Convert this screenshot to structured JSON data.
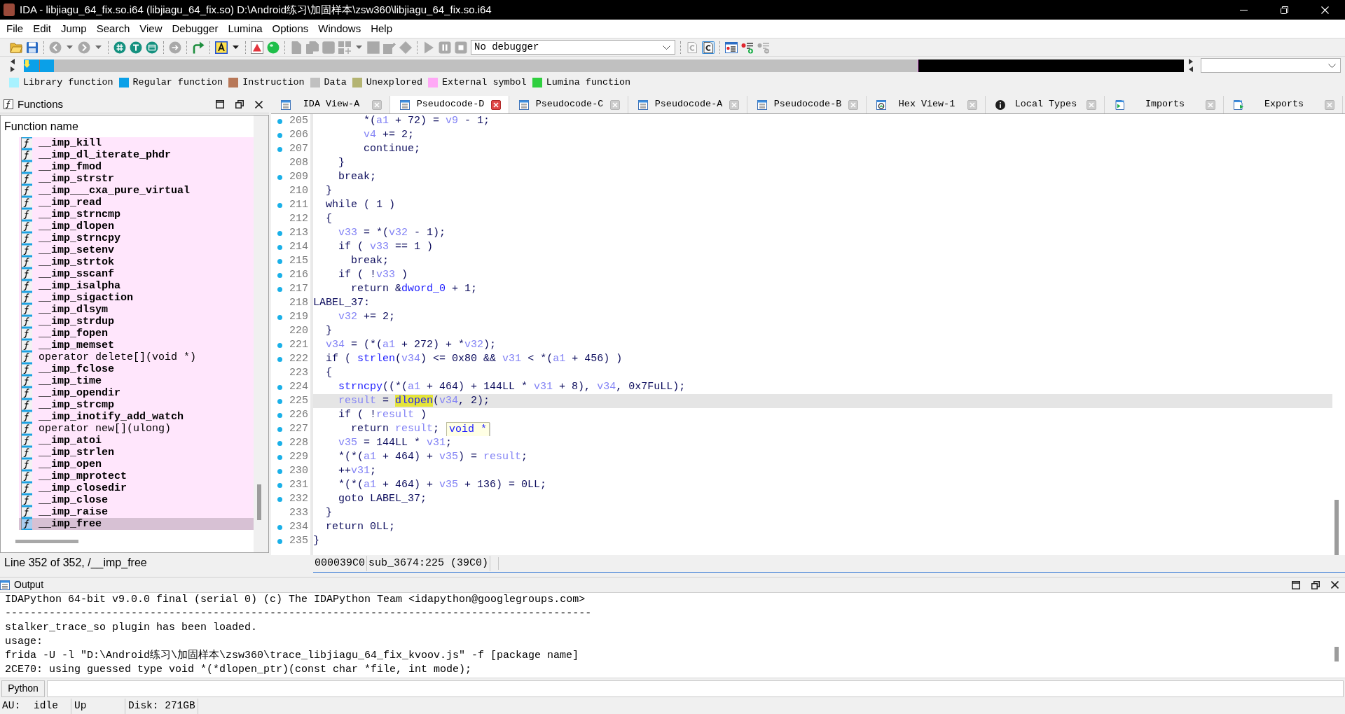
{
  "window": {
    "title": "IDA - libjiagu_64_fix.so.i64 (libjiagu_64_fix.so) D:\\Android练习\\加固样本\\zsw360\\libjiagu_64_fix.so.i64"
  },
  "menu": [
    "File",
    "Edit",
    "Jump",
    "Search",
    "View",
    "Debugger",
    "Lumina",
    "Options",
    "Windows",
    "Help"
  ],
  "toolbar": [
    [
      {
        "kind": "folder",
        "disabled": false,
        "pressed": false
      },
      {
        "kind": "save",
        "disabled": false,
        "pressed": false
      }
    ],
    [
      {
        "kind": "back",
        "disabled": true,
        "pressed": false
      },
      {
        "kind": "caret",
        "disabled": true,
        "pressed": false
      },
      {
        "kind": "forward",
        "disabled": true,
        "pressed": false
      },
      {
        "kind": "caret",
        "disabled": true,
        "pressed": false
      }
    ],
    [
      {
        "kind": "grid-circle",
        "disabled": false,
        "pressed": false
      },
      {
        "kind": "text-circle",
        "disabled": false,
        "pressed": false
      },
      {
        "kind": "window-circle",
        "disabled": false,
        "pressed": false
      }
    ],
    [
      {
        "kind": "arrow-circle",
        "disabled": true,
        "pressed": false
      }
    ],
    [
      {
        "kind": "curved-arrow",
        "disabled": false,
        "pressed": false
      }
    ],
    [
      {
        "kind": "font-color",
        "disabled": false,
        "pressed": false
      },
      {
        "kind": "caret",
        "disabled": false,
        "pressed": false
      }
    ],
    [
      {
        "kind": "triangle",
        "disabled": false,
        "pressed": false
      },
      {
        "kind": "ball",
        "disabled": false,
        "pressed": false
      }
    ],
    [
      {
        "kind": "page",
        "disabled": true,
        "pressed": false
      },
      {
        "kind": "pages",
        "disabled": true,
        "pressed": false
      },
      {
        "kind": "frame",
        "disabled": true,
        "pressed": false
      },
      {
        "kind": "blocks",
        "disabled": true,
        "pressed": false
      },
      {
        "kind": "caret",
        "disabled": true,
        "pressed": false
      },
      {
        "kind": "square",
        "disabled": true,
        "pressed": false
      },
      {
        "kind": "pencil",
        "disabled": true,
        "pressed": false
      },
      {
        "kind": "diamond",
        "disabled": true,
        "pressed": false
      }
    ],
    [
      {
        "kind": "play",
        "disabled": true,
        "pressed": false
      },
      {
        "kind": "pause",
        "disabled": true,
        "pressed": false
      },
      {
        "kind": "stop",
        "disabled": true,
        "pressed": false
      },
      {
        "kind": "select",
        "value": "No debugger",
        "disabled": false,
        "pressed": false
      }
    ],
    [
      {
        "kind": "c-document",
        "disabled": true,
        "pressed": false
      },
      {
        "kind": "c-document",
        "disabled": false,
        "pressed": true
      }
    ],
    [
      {
        "kind": "list",
        "disabled": false,
        "pressed": false
      },
      {
        "kind": "list-add",
        "disabled": false,
        "pressed": false
      },
      {
        "kind": "list-remove",
        "disabled": true,
        "pressed": false
      }
    ]
  ],
  "legend": [
    {
      "label": "Library function",
      "color": "#a8f2ff"
    },
    {
      "label": "Regular function",
      "color": "#0aa0e8"
    },
    {
      "label": "Instruction",
      "color": "#b87858"
    },
    {
      "label": "Data",
      "color": "#c0c0c0"
    },
    {
      "label": "Unexplored",
      "color": "#b4b472"
    },
    {
      "label": "External symbol",
      "color": "#ffa8f6"
    },
    {
      "label": "Lumina function",
      "color": "#2fcf3f"
    }
  ],
  "functions_panel": {
    "title": "Functions",
    "column": "Function name",
    "rows": [
      {
        "name": "__imp_kill",
        "bold": true,
        "selected": false
      },
      {
        "name": "__imp_dl_iterate_phdr",
        "bold": true,
        "selected": false
      },
      {
        "name": "__imp_fmod",
        "bold": true,
        "selected": false
      },
      {
        "name": "__imp_strstr",
        "bold": true,
        "selected": false
      },
      {
        "name": "__imp___cxa_pure_virtual",
        "bold": true,
        "selected": false
      },
      {
        "name": "__imp_read",
        "bold": true,
        "selected": false
      },
      {
        "name": "__imp_strncmp",
        "bold": true,
        "selected": false
      },
      {
        "name": "__imp_dlopen",
        "bold": true,
        "selected": false
      },
      {
        "name": "__imp_strncpy",
        "bold": true,
        "selected": false
      },
      {
        "name": "__imp_setenv",
        "bold": true,
        "selected": false
      },
      {
        "name": "__imp_strtok",
        "bold": true,
        "selected": false
      },
      {
        "name": "__imp_sscanf",
        "bold": true,
        "selected": false
      },
      {
        "name": "__imp_isalpha",
        "bold": true,
        "selected": false
      },
      {
        "name": "__imp_sigaction",
        "bold": true,
        "selected": false
      },
      {
        "name": "__imp_dlsym",
        "bold": true,
        "selected": false
      },
      {
        "name": "__imp_strdup",
        "bold": true,
        "selected": false
      },
      {
        "name": "__imp_fopen",
        "bold": true,
        "selected": false
      },
      {
        "name": "__imp_memset",
        "bold": true,
        "selected": false
      },
      {
        "name": "operator delete[](void *)",
        "bold": false,
        "selected": false
      },
      {
        "name": "__imp_fclose",
        "bold": true,
        "selected": false
      },
      {
        "name": "__imp_time",
        "bold": true,
        "selected": false
      },
      {
        "name": "__imp_opendir",
        "bold": true,
        "selected": false
      },
      {
        "name": "__imp_strcmp",
        "bold": true,
        "selected": false
      },
      {
        "name": "__imp_inotify_add_watch",
        "bold": true,
        "selected": false
      },
      {
        "name": "operator new[](ulong)",
        "bold": false,
        "selected": false
      },
      {
        "name": "__imp_atoi",
        "bold": true,
        "selected": false
      },
      {
        "name": "__imp_strlen",
        "bold": true,
        "selected": false
      },
      {
        "name": "__imp_open",
        "bold": true,
        "selected": false
      },
      {
        "name": "__imp_mprotect",
        "bold": true,
        "selected": false
      },
      {
        "name": "__imp_closedir",
        "bold": true,
        "selected": false
      },
      {
        "name": "__imp_close",
        "bold": true,
        "selected": false
      },
      {
        "name": "__imp_raise",
        "bold": true,
        "selected": false
      },
      {
        "name": "__imp_free",
        "bold": true,
        "selected": true
      }
    ],
    "status": "Line 352 of 352, /__imp_free"
  },
  "tabs": [
    {
      "label": "IDA View-A",
      "kind": "listing",
      "selected": false
    },
    {
      "label": "Pseudocode-D",
      "kind": "listing",
      "selected": true
    },
    {
      "label": "Pseudocode-C",
      "kind": "listing",
      "selected": false
    },
    {
      "label": "Pseudocode-A",
      "kind": "listing",
      "selected": false
    },
    {
      "label": "Pseudocode-B",
      "kind": "listing",
      "selected": false
    },
    {
      "label": "Hex View-1",
      "kind": "hex",
      "selected": false
    },
    {
      "label": "Local Types",
      "kind": "types",
      "selected": false
    },
    {
      "label": "Imports",
      "kind": "imports",
      "selected": false
    },
    {
      "label": "Exports",
      "kind": "exports",
      "selected": false
    }
  ],
  "pseudocode": {
    "lines": [
      {
        "number": "205",
        "dot": true,
        "current": false,
        "tokens": [
          {
            "text": "        *(",
            "kind": "plain"
          },
          {
            "text": "a1",
            "kind": "var"
          },
          {
            "text": " + 72) = ",
            "kind": "plain"
          },
          {
            "text": "v9",
            "kind": "var"
          },
          {
            "text": " - 1;",
            "kind": "plain"
          }
        ]
      },
      {
        "number": "206",
        "dot": true,
        "current": false,
        "tokens": [
          {
            "text": "        v4",
            "kind": "var"
          },
          {
            "text": " += 2;",
            "kind": "plain"
          }
        ]
      },
      {
        "number": "207",
        "dot": true,
        "current": false,
        "tokens": [
          {
            "text": "        continue;",
            "kind": "plain"
          }
        ]
      },
      {
        "number": "208",
        "dot": false,
        "current": false,
        "tokens": [
          {
            "text": "    }",
            "kind": "plain"
          }
        ]
      },
      {
        "number": "209",
        "dot": true,
        "current": false,
        "tokens": [
          {
            "text": "    break;",
            "kind": "plain"
          }
        ]
      },
      {
        "number": "210",
        "dot": false,
        "current": false,
        "tokens": [
          {
            "text": "  }",
            "kind": "plain"
          }
        ]
      },
      {
        "number": "211",
        "dot": true,
        "current": false,
        "tokens": [
          {
            "text": "  while ( 1 )",
            "kind": "plain"
          }
        ]
      },
      {
        "number": "212",
        "dot": false,
        "current": false,
        "tokens": [
          {
            "text": "  {",
            "kind": "plain"
          }
        ]
      },
      {
        "number": "213",
        "dot": true,
        "current": false,
        "tokens": [
          {
            "text": "    v33",
            "kind": "var"
          },
          {
            "text": " = *(",
            "kind": "plain"
          },
          {
            "text": "v32",
            "kind": "var"
          },
          {
            "text": " - 1);",
            "kind": "plain"
          }
        ]
      },
      {
        "number": "214",
        "dot": true,
        "current": false,
        "tokens": [
          {
            "text": "    if ( ",
            "kind": "plain"
          },
          {
            "text": "v33",
            "kind": "var"
          },
          {
            "text": " == 1 )",
            "kind": "plain"
          }
        ]
      },
      {
        "number": "215",
        "dot": true,
        "current": false,
        "tokens": [
          {
            "text": "      break;",
            "kind": "plain"
          }
        ]
      },
      {
        "number": "216",
        "dot": true,
        "current": false,
        "tokens": [
          {
            "text": "    if ( !",
            "kind": "plain"
          },
          {
            "text": "v33",
            "kind": "var"
          },
          {
            "text": " )",
            "kind": "plain"
          }
        ]
      },
      {
        "number": "217",
        "dot": true,
        "current": false,
        "tokens": [
          {
            "text": "      return &",
            "kind": "plain"
          },
          {
            "text": "dword_0",
            "kind": "name"
          },
          {
            "text": " + 1;",
            "kind": "plain"
          }
        ]
      },
      {
        "number": "218",
        "dot": false,
        "current": false,
        "tokens": [
          {
            "text": "LABEL_37:",
            "kind": "plain"
          }
        ]
      },
      {
        "number": "219",
        "dot": true,
        "current": false,
        "tokens": [
          {
            "text": "    v32",
            "kind": "var"
          },
          {
            "text": " += 2;",
            "kind": "plain"
          }
        ]
      },
      {
        "number": "220",
        "dot": false,
        "current": false,
        "tokens": [
          {
            "text": "  }",
            "kind": "plain"
          }
        ]
      },
      {
        "number": "221",
        "dot": true,
        "current": false,
        "tokens": [
          {
            "text": "  v34",
            "kind": "var"
          },
          {
            "text": " = (*(",
            "kind": "plain"
          },
          {
            "text": "a1",
            "kind": "var"
          },
          {
            "text": " + 272) + *",
            "kind": "plain"
          },
          {
            "text": "v32",
            "kind": "var"
          },
          {
            "text": ");",
            "kind": "plain"
          }
        ]
      },
      {
        "number": "222",
        "dot": true,
        "current": false,
        "tokens": [
          {
            "text": "  if ( ",
            "kind": "plain"
          },
          {
            "text": "strlen",
            "kind": "name"
          },
          {
            "text": "(",
            "kind": "plain"
          },
          {
            "text": "v34",
            "kind": "var"
          },
          {
            "text": ") <= 0x80 && ",
            "kind": "plain"
          },
          {
            "text": "v31",
            "kind": "var"
          },
          {
            "text": " < *(",
            "kind": "plain"
          },
          {
            "text": "a1",
            "kind": "var"
          },
          {
            "text": " + 456) )",
            "kind": "plain"
          }
        ]
      },
      {
        "number": "223",
        "dot": false,
        "current": false,
        "tokens": [
          {
            "text": "  {",
            "kind": "plain"
          }
        ]
      },
      {
        "number": "224",
        "dot": true,
        "current": false,
        "tokens": [
          {
            "text": "    strncpy",
            "kind": "name"
          },
          {
            "text": "((*(",
            "kind": "plain"
          },
          {
            "text": "a1",
            "kind": "var"
          },
          {
            "text": " + 464) + 144LL * ",
            "kind": "plain"
          },
          {
            "text": "v31",
            "kind": "var"
          },
          {
            "text": " + 8), ",
            "kind": "plain"
          },
          {
            "text": "v34",
            "kind": "var"
          },
          {
            "text": ", 0x7FuLL);",
            "kind": "plain"
          }
        ]
      },
      {
        "number": "225",
        "dot": true,
        "current": true,
        "tokens": [
          {
            "text": "    result",
            "kind": "var"
          },
          {
            "text": " = ",
            "kind": "plain"
          },
          {
            "text": "dlopen",
            "kind": "match"
          },
          {
            "text": "(",
            "kind": "plain"
          },
          {
            "text": "v34",
            "kind": "var"
          },
          {
            "text": ", 2);",
            "kind": "plain"
          }
        ]
      },
      {
        "number": "226",
        "dot": true,
        "current": false,
        "tokens": [
          {
            "text": "    if ( !",
            "kind": "plain"
          },
          {
            "text": "result",
            "kind": "var"
          },
          {
            "text": " )",
            "kind": "plain"
          }
        ]
      },
      {
        "number": "227",
        "dot": true,
        "current": false,
        "tokens": [
          {
            "text": "      return ",
            "kind": "plain"
          },
          {
            "text": "result",
            "kind": "var"
          },
          {
            "text": ";",
            "kind": "plain"
          }
        ],
        "tooltip": "void *"
      },
      {
        "number": "228",
        "dot": true,
        "current": false,
        "tokens": [
          {
            "text": "    v35",
            "kind": "var"
          },
          {
            "text": " = 144LL * ",
            "kind": "plain"
          },
          {
            "text": "v31",
            "kind": "var"
          },
          {
            "text": ";",
            "kind": "plain"
          }
        ]
      },
      {
        "number": "229",
        "dot": true,
        "current": false,
        "tokens": [
          {
            "text": "    *(*(",
            "kind": "plain"
          },
          {
            "text": "a1",
            "kind": "var"
          },
          {
            "text": " + 464) + ",
            "kind": "plain"
          },
          {
            "text": "v35",
            "kind": "var"
          },
          {
            "text": ") = ",
            "kind": "plain"
          },
          {
            "text": "result",
            "kind": "var"
          },
          {
            "text": ";",
            "kind": "plain"
          }
        ]
      },
      {
        "number": "230",
        "dot": true,
        "current": false,
        "tokens": [
          {
            "text": "    ++",
            "kind": "plain"
          },
          {
            "text": "v31",
            "kind": "var"
          },
          {
            "text": ";",
            "kind": "plain"
          }
        ]
      },
      {
        "number": "231",
        "dot": true,
        "current": false,
        "tokens": [
          {
            "text": "    *(*(",
            "kind": "plain"
          },
          {
            "text": "a1",
            "kind": "var"
          },
          {
            "text": " + 464) + ",
            "kind": "plain"
          },
          {
            "text": "v35",
            "kind": "var"
          },
          {
            "text": " + 136) = 0LL;",
            "kind": "plain"
          }
        ]
      },
      {
        "number": "232",
        "dot": true,
        "current": false,
        "tokens": [
          {
            "text": "    goto LABEL_37;",
            "kind": "plain"
          }
        ]
      },
      {
        "number": "233",
        "dot": false,
        "current": false,
        "tokens": [
          {
            "text": "  }",
            "kind": "plain"
          }
        ]
      },
      {
        "number": "234",
        "dot": true,
        "current": false,
        "tokens": [
          {
            "text": "  return 0LL;",
            "kind": "plain"
          }
        ]
      },
      {
        "number": "235",
        "dot": true,
        "current": false,
        "tokens": [
          {
            "text": "}",
            "kind": "plain"
          }
        ]
      }
    ],
    "status": [
      "000039C0",
      "sub_3674:225 (39C0)"
    ]
  },
  "output": {
    "title": "Output",
    "lines": [
      "IDAPython 64-bit v9.0.0 final (serial 0) (c) The IDAPython Team <idapython@googlegroups.com>",
      "---------------------------------------------------------------------------------------------",
      "stalker_trace_so plugin has been loaded.",
      "usage:",
      "frida -U -l \"D:\\Android练习\\加固样本\\zsw360\\trace_libjiagu_64_fix_kvoov.js\" -f [package name]",
      "2CE70: using guessed type void *(*dlopen_ptr)(const char *file, int mode);"
    ]
  },
  "console": {
    "language": "Python"
  },
  "status_bar": {
    "cells": [
      [
        "AU:",
        "idle"
      ],
      [
        "Up"
      ],
      [
        "Disk: 271GB"
      ]
    ]
  }
}
